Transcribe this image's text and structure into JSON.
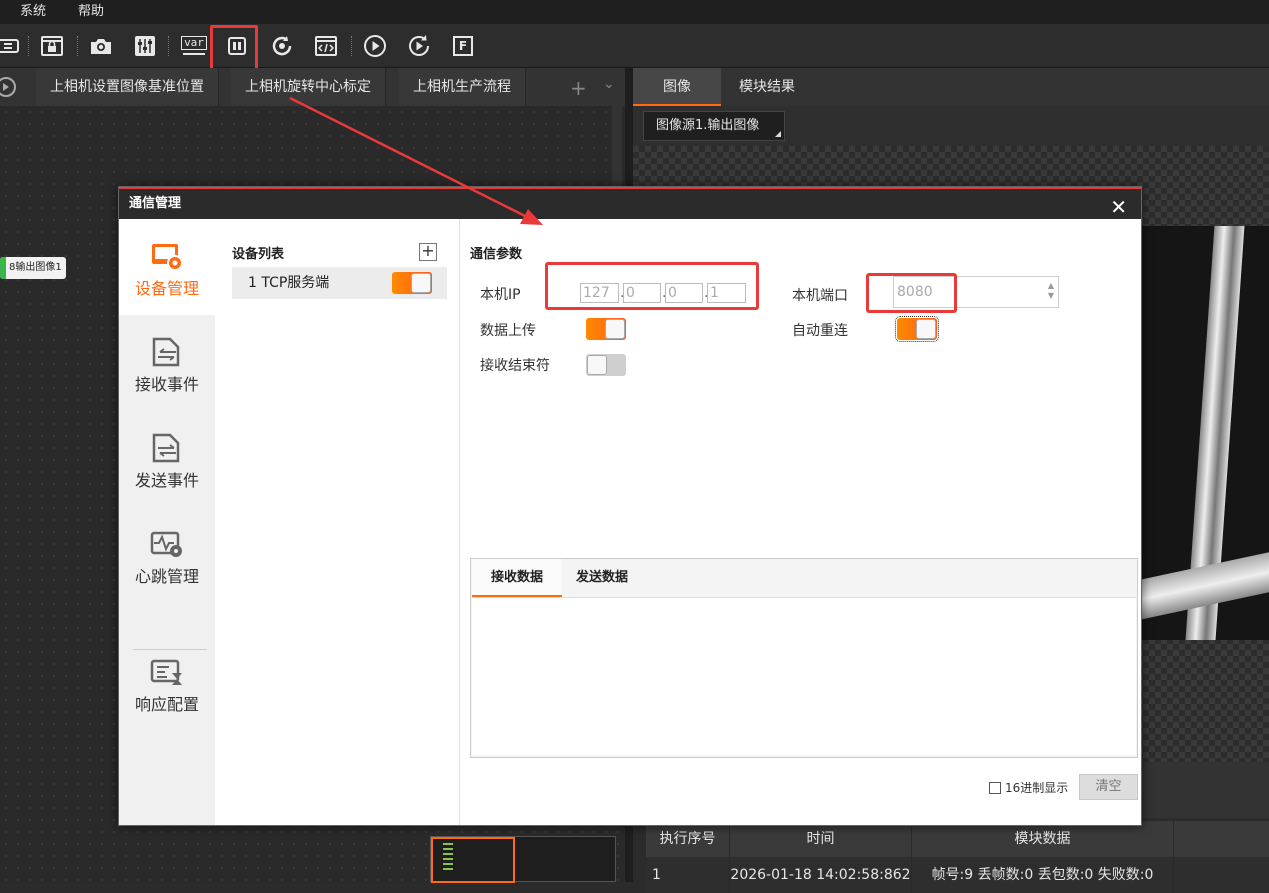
{
  "menu": {
    "items": [
      "系统",
      "帮助"
    ]
  },
  "toolbar": {
    "icons": [
      "global-var-icon",
      "lock-window-icon",
      "camera-icon",
      "adjust-icon",
      "var-icon",
      "communication-icon",
      "rotate-icon",
      "code-icon",
      "run-once-icon",
      "run-loop-icon",
      "format-icon"
    ],
    "var_text": "var",
    "format_text": "F"
  },
  "flow_tabs": {
    "tabs": [
      "上相机设置图像基准位置",
      "上相机旋转中心标定",
      "上相机生产流程"
    ],
    "add_symbol": "+",
    "more_symbol": "⌄"
  },
  "canvas": {
    "node_label": "8输出图像1"
  },
  "right_panel": {
    "tabs": [
      "图像",
      "模块结果"
    ],
    "image_source": "图像源1.输出图像",
    "table": {
      "columns": [
        "执行序号",
        "时间",
        "模块数据"
      ],
      "rows": [
        {
          "index": "1",
          "time": "2026-01-18 14:02:58:862",
          "data": "帧号:9 丢帧数:0 丢包数:0 失败数:0"
        }
      ]
    }
  },
  "dialog": {
    "title": "通信管理",
    "close": "✕",
    "nav": [
      "设备管理",
      "接收事件",
      "发送事件",
      "心跳管理",
      "响应配置"
    ],
    "active_nav": "设备管理",
    "device_list": {
      "title": "设备列表",
      "add": "+",
      "devices": [
        {
          "label": "1 TCP服务端",
          "enabled": true
        }
      ]
    },
    "params": {
      "title": "通信参数",
      "local_ip_label": "本机IP",
      "ip": [
        "127",
        "0",
        "0",
        "1"
      ],
      "ip_dot": ".",
      "local_port_label": "本机端口",
      "port": "8080",
      "data_upload_label": "数据上传",
      "data_upload": true,
      "auto_reconnect_label": "自动重连",
      "auto_reconnect": true,
      "recv_terminator_label": "接收结束符",
      "recv_terminator": false
    },
    "data_panel": {
      "tabs": [
        "接收数据",
        "发送数据"
      ],
      "hex_label": "16进制显示",
      "clear_button": "清空"
    }
  },
  "colors": {
    "accent": "#ff6a13",
    "highlight": "#e8393b"
  }
}
